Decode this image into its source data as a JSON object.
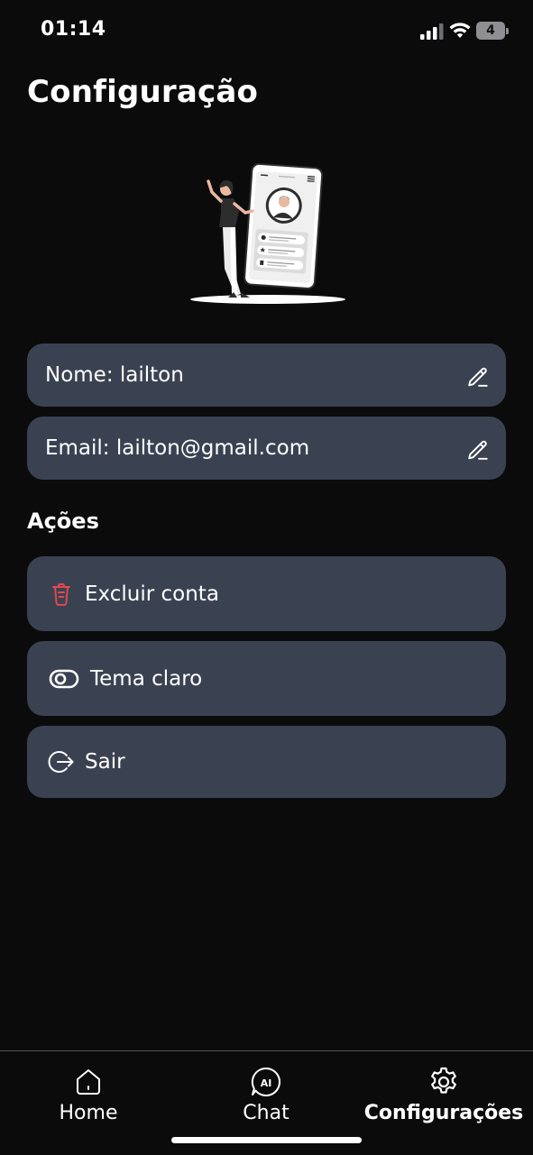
{
  "status_bar": {
    "time": "01:14",
    "battery_level": "4"
  },
  "page": {
    "title": "Configuração"
  },
  "profile": {
    "name_field": "Nome: lailton",
    "email_field": "Email: lailton@gmail.com"
  },
  "actions": {
    "section_title": "Ações",
    "items": [
      {
        "label": "Excluir conta",
        "icon": "trash-icon",
        "icon_color": "#e5484d"
      },
      {
        "label": "Tema claro",
        "icon": "toggle-icon"
      },
      {
        "label": "Sair",
        "icon": "logout-icon"
      }
    ]
  },
  "bottom_nav": {
    "items": [
      {
        "label": "Home",
        "icon": "home-icon",
        "active": false
      },
      {
        "label": "Chat",
        "icon": "ai-chat-icon",
        "active": false
      },
      {
        "label": "Configurações",
        "icon": "gear-icon",
        "active": true
      }
    ]
  },
  "colors": {
    "background": "#0b0b0c",
    "card": "#3a4252",
    "danger": "#e5484d",
    "text": "#ffffff"
  }
}
